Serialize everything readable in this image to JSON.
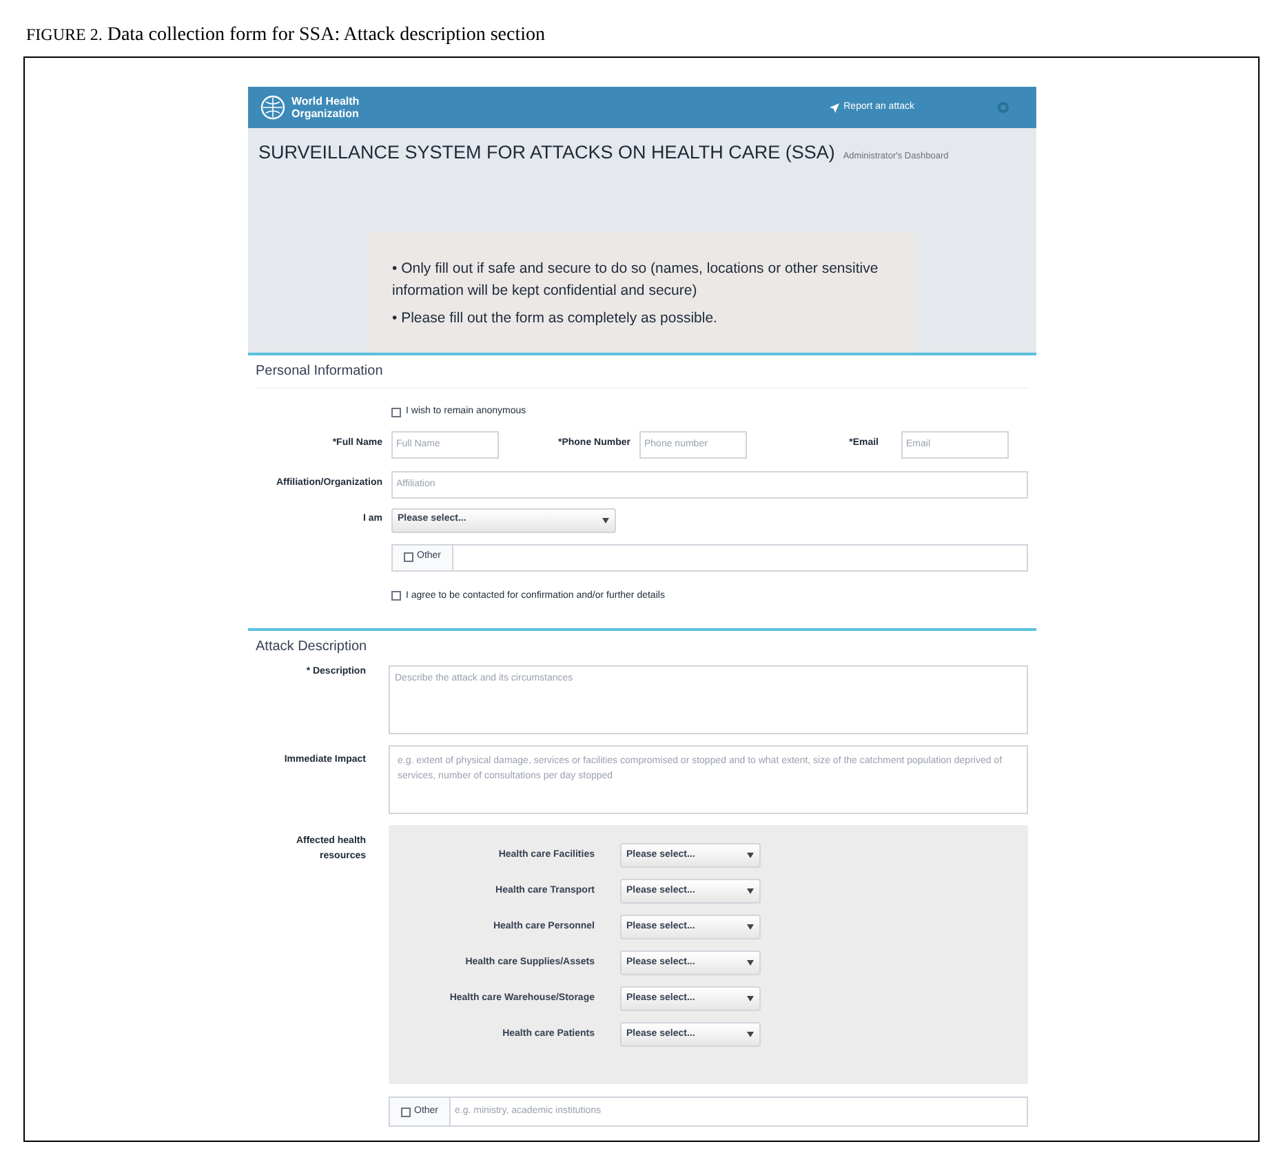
{
  "caption": {
    "label": "FIGURE 2.",
    "text": "Data collection form for SSA: Attack description section"
  },
  "header": {
    "brand": [
      "World Health",
      "Organization"
    ],
    "report_link": "Report an attack"
  },
  "title": "SURVEILLANCE SYSTEM FOR ATTACKS ON HEALTH CARE (SSA)",
  "subtitle": "Administrator's Dashboard",
  "notice": [
    "• Only fill out if safe and secure to do so (names, locations or other sensitive information will be kept confidential and secure)",
    "• Please fill out the form as completely as possible."
  ],
  "personal": {
    "heading": "Personal Information",
    "anonymous": {
      "label": "I wish to remain anonymous",
      "checked": false
    },
    "fields": [
      {
        "label": "*Full Name",
        "placeholder": "Full Name"
      },
      {
        "label": "*Phone Number",
        "placeholder": "Phone number"
      },
      {
        "label": "*Email",
        "placeholder": "Email"
      }
    ],
    "affiliation": {
      "label": "Affiliation/Organization",
      "placeholder": "Affiliation"
    },
    "i_am": {
      "label": "I am",
      "value": "Please select..."
    },
    "other": {
      "label": "Other",
      "checked": false
    },
    "agree": {
      "label": "I agree to be contacted for confirmation and/or further details",
      "checked": false
    }
  },
  "attack": {
    "heading": "Attack Description",
    "description": {
      "label": "* Description",
      "placeholder": "Describe the attack and its circumstances"
    },
    "impact": {
      "label": "Immediate Impact",
      "placeholder": "e.g. extent of physical damage, services or facilities compromised or stopped and to what extent, size of the catchment population deprived of services, number of consultations per day stopped"
    },
    "affected": {
      "label": "Affected health resources",
      "rows": [
        {
          "label": "Health care Facilities",
          "value": "Please select..."
        },
        {
          "label": "Health care Transport",
          "value": "Please select..."
        },
        {
          "label": "Health care Personnel",
          "value": "Please select..."
        },
        {
          "label": "Health care Supplies/Assets",
          "value": "Please select..."
        },
        {
          "label": "Health care Warehouse/Storage",
          "value": "Please select..."
        },
        {
          "label": "Health care Patients",
          "value": "Please select..."
        }
      ]
    },
    "other": {
      "label": "Other",
      "checked": false,
      "placeholder": "e.g. ministry, academic institutions"
    }
  }
}
